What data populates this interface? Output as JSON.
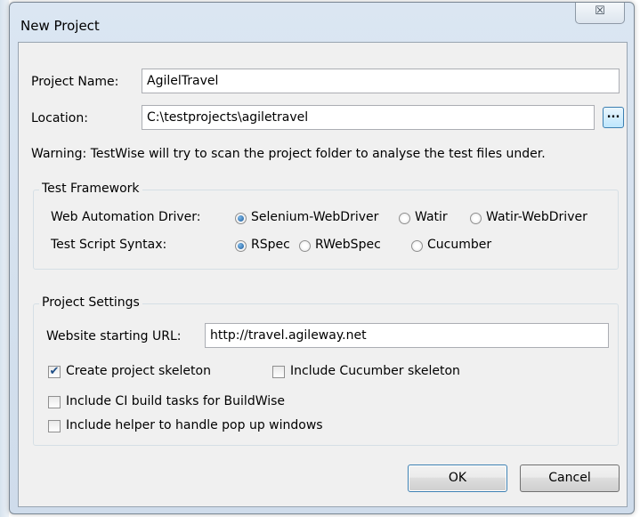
{
  "window": {
    "title": "New Project",
    "close_glyph": "☒"
  },
  "project_name": {
    "label": "Project Name:",
    "value": "AgilelTravel"
  },
  "location": {
    "label": "Location:",
    "value": "C:\\testprojects\\agiletravel",
    "browse_label": "..."
  },
  "warning": "Warning: TestWise will try to scan the project folder to analyse the test files under.",
  "test_framework": {
    "title": "Test Framework",
    "driver_label": "Web Automation Driver:",
    "drivers": [
      {
        "label": "Selenium-WebDriver",
        "selected": true
      },
      {
        "label": "Watir",
        "selected": false
      },
      {
        "label": "Watir-WebDriver",
        "selected": false
      }
    ],
    "syntax_label": "Test Script Syntax:",
    "syntaxes": [
      {
        "label": "RSpec",
        "selected": true
      },
      {
        "label": "RWebSpec",
        "selected": false
      },
      {
        "label": "Cucumber",
        "selected": false
      }
    ]
  },
  "project_settings": {
    "title": "Project Settings",
    "url_label": "Website starting URL:",
    "url_value": "http://travel.agileway.net",
    "options": [
      {
        "label": "Create project skeleton",
        "checked": true
      },
      {
        "label": "Include Cucumber skeleton",
        "checked": false
      },
      {
        "label": "Include CI build tasks for BuildWise",
        "checked": false
      },
      {
        "label": "Include helper to handle pop up windows",
        "checked": false
      }
    ]
  },
  "buttons": {
    "ok": "OK",
    "cancel": "Cancel"
  },
  "colors": {
    "accent": "#3c7fb1",
    "client_bg": "#f0f0f0",
    "frame": "#cfdceb"
  }
}
